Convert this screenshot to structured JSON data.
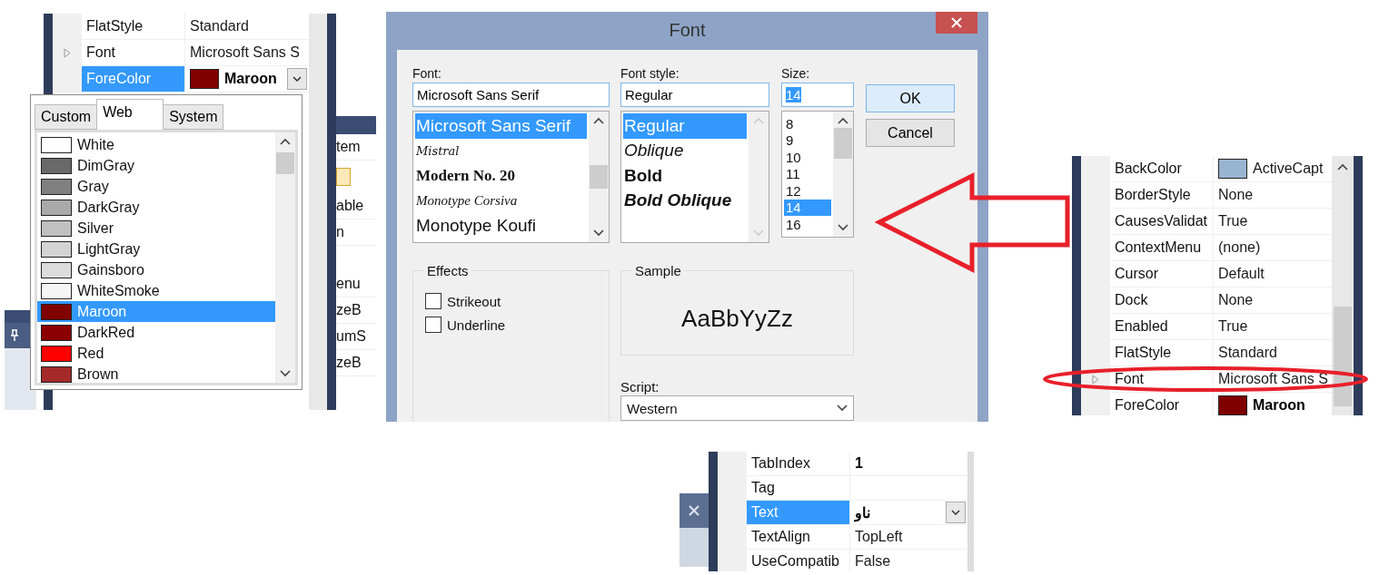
{
  "left_panel": {
    "rows": [
      {
        "name": "FlatStyle",
        "value": "Standard",
        "expandable": false,
        "selected": false,
        "modified": false
      },
      {
        "name": "Font",
        "value": "Microsoft Sans S",
        "expandable": true,
        "selected": false,
        "modified": false
      },
      {
        "name": "ForeColor",
        "value": "Maroon",
        "color": "#800000",
        "expandable": false,
        "selected": true,
        "modified": true
      }
    ],
    "background_fragments": [
      "tem",
      "able",
      "n",
      "enu",
      "zeB",
      "umS",
      "zeB"
    ],
    "color_picker": {
      "tabs": [
        {
          "label": "Custom",
          "selected": false
        },
        {
          "label": "Web",
          "selected": true
        },
        {
          "label": "System",
          "selected": false
        }
      ],
      "colors": [
        {
          "name": "White",
          "color": "#ffffff",
          "selected": false
        },
        {
          "name": "DimGray",
          "color": "#696969",
          "selected": false
        },
        {
          "name": "Gray",
          "color": "#808080",
          "selected": false
        },
        {
          "name": "DarkGray",
          "color": "#a9a9a9",
          "selected": false
        },
        {
          "name": "Silver",
          "color": "#c0c0c0",
          "selected": false
        },
        {
          "name": "LightGray",
          "color": "#d3d3d3",
          "selected": false
        },
        {
          "name": "Gainsboro",
          "color": "#dcdcdc",
          "selected": false
        },
        {
          "name": "WhiteSmoke",
          "color": "#f5f5f5",
          "selected": false
        },
        {
          "name": "Maroon",
          "color": "#800000",
          "selected": true
        },
        {
          "name": "DarkRed",
          "color": "#8b0000",
          "selected": false
        },
        {
          "name": "Red",
          "color": "#ff0000",
          "selected": false
        },
        {
          "name": "Brown",
          "color": "#a52a2a",
          "selected": false
        }
      ]
    }
  },
  "font_dialog": {
    "title": "Font",
    "font": {
      "label": "Font:",
      "value": "Microsoft Sans Serif",
      "items": [
        {
          "name": "Microsoft Sans Serif",
          "kind": "sans",
          "selected": true
        },
        {
          "name": "Mistral",
          "kind": "script",
          "selected": false
        },
        {
          "name": "Modern No. 20",
          "kind": "modern",
          "selected": false
        },
        {
          "name": "Monotype Corsiva",
          "kind": "cursive",
          "selected": false
        },
        {
          "name": "Monotype Koufi",
          "kind": "sans",
          "selected": false
        }
      ]
    },
    "style": {
      "label": "Font style:",
      "value": "Regular",
      "items": [
        {
          "name": "Regular",
          "kind": "regular",
          "selected": true
        },
        {
          "name": "Oblique",
          "kind": "oblique",
          "selected": false
        },
        {
          "name": "Bold",
          "kind": "bold",
          "selected": false
        },
        {
          "name": "Bold Oblique",
          "kind": "bold-oblique",
          "selected": false
        }
      ]
    },
    "size": {
      "label": "Size:",
      "value": "14",
      "items": [
        {
          "name": "8",
          "selected": false
        },
        {
          "name": "9",
          "selected": false
        },
        {
          "name": "10",
          "selected": false
        },
        {
          "name": "11",
          "selected": false
        },
        {
          "name": "12",
          "selected": false
        },
        {
          "name": "14",
          "selected": true
        },
        {
          "name": "16",
          "selected": false
        }
      ]
    },
    "buttons": [
      {
        "label": "OK",
        "default": true
      },
      {
        "label": "Cancel",
        "default": false
      }
    ],
    "effects": {
      "title": "Effects",
      "options": [
        {
          "label": "Strikeout",
          "checked": false
        },
        {
          "label": "Underline",
          "checked": false
        }
      ]
    },
    "sample": {
      "title": "Sample",
      "text": "AaBbYyZz"
    },
    "script": {
      "label": "Script:",
      "value": "Western"
    }
  },
  "right_panel": {
    "rows": [
      {
        "name": "BackColor",
        "value": "ActiveCapt",
        "color": "#99b4d1",
        "expandable": false,
        "selected": false,
        "modified": false
      },
      {
        "name": "BorderStyle",
        "value": "None",
        "expandable": false,
        "selected": false,
        "modified": false
      },
      {
        "name": "CausesValidat",
        "value": "True",
        "expandable": false,
        "selected": false,
        "modified": false
      },
      {
        "name": "ContextMenu",
        "value": "(none)",
        "expandable": false,
        "selected": false,
        "modified": false
      },
      {
        "name": "Cursor",
        "value": "Default",
        "expandable": false,
        "selected": false,
        "modified": false
      },
      {
        "name": "Dock",
        "value": "None",
        "expandable": false,
        "selected": false,
        "modified": false
      },
      {
        "name": "Enabled",
        "value": "True",
        "expandable": false,
        "selected": false,
        "modified": false
      },
      {
        "name": "FlatStyle",
        "value": "Standard",
        "expandable": false,
        "selected": false,
        "modified": false
      },
      {
        "name": "Font",
        "value": "Microsoft Sans S",
        "expandable": true,
        "selected": false,
        "modified": false
      },
      {
        "name": "ForeColor",
        "value": "Maroon",
        "color": "#800000",
        "expandable": false,
        "selected": false,
        "modified": true
      }
    ]
  },
  "bottom_panel": {
    "rows": [
      {
        "name": "TabIndex",
        "value": "1",
        "expandable": false,
        "selected": false,
        "modified": true
      },
      {
        "name": "Tag",
        "expandable": false,
        "selected": false
      },
      {
        "name": "Text",
        "value": "ناو",
        "expandable": false,
        "selected": true,
        "modified": true
      },
      {
        "name": "TextAlign",
        "value": "TopLeft",
        "expandable": false,
        "selected": false,
        "modified": false
      },
      {
        "name": "UseCompatib",
        "value": "False",
        "expandable": false,
        "selected": false,
        "modified": false
      }
    ]
  }
}
